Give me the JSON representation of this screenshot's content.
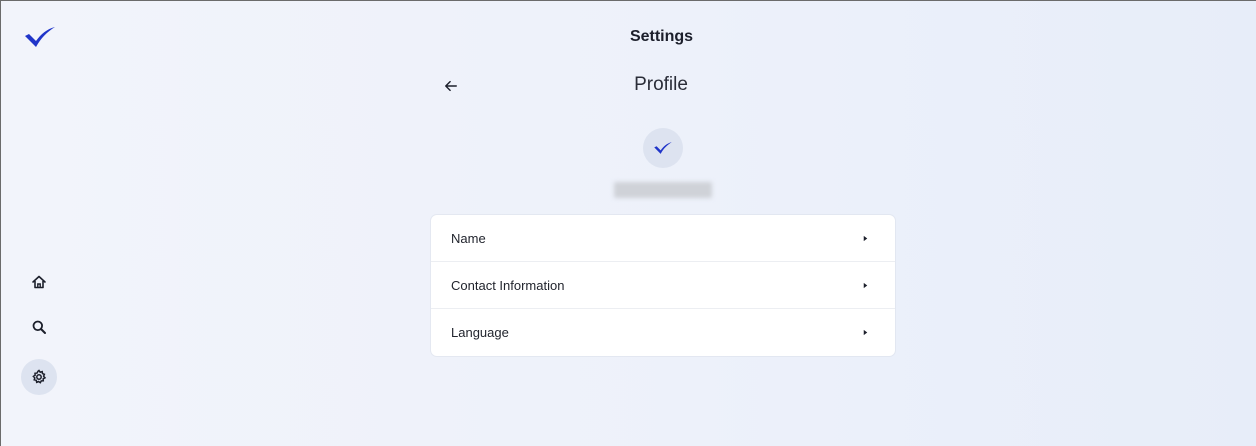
{
  "header": {
    "title": "Settings"
  },
  "page": {
    "title": "Profile"
  },
  "profile_menu": {
    "items": [
      {
        "label": "Name"
      },
      {
        "label": "Contact Information"
      },
      {
        "label": "Language"
      }
    ]
  },
  "sidebar": {
    "items": [
      {
        "icon": "home-icon",
        "active": false
      },
      {
        "icon": "search-icon",
        "active": false
      },
      {
        "icon": "gear-icon",
        "active": true
      }
    ]
  },
  "colors": {
    "brand": "#2035c9",
    "background": "#eef1fa",
    "card": "#ffffff",
    "active_nav_bg": "#dde3f0"
  }
}
